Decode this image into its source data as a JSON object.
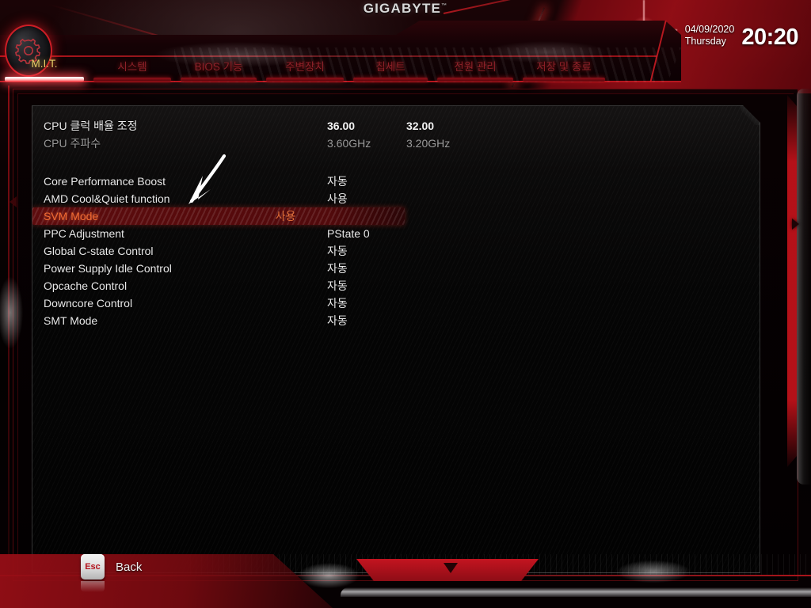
{
  "brand": {
    "logo": "GIGABYTE",
    "trademark": "™",
    "gear_icon": "gear-icon"
  },
  "clock": {
    "date": "04/09/2020",
    "weekday": "Thursday",
    "time": "20:20"
  },
  "tabs": [
    {
      "label": "M.I.T.",
      "active": true
    },
    {
      "label": "시스템",
      "active": false
    },
    {
      "label": "BIOS 기능",
      "active": false
    },
    {
      "label": "주변장치",
      "active": false
    },
    {
      "label": "칩세트",
      "active": false
    },
    {
      "label": "전원 관리",
      "active": false
    },
    {
      "label": "저장 및 종료",
      "active": false
    }
  ],
  "settings": {
    "summary_rows": [
      {
        "label": "CPU 클럭 배율 조정",
        "value1": "36.00",
        "value2": "32.00",
        "style": "bold"
      },
      {
        "label": "CPU 주파수",
        "value1": "3.60GHz",
        "value2": "3.20GHz",
        "style": "dim"
      }
    ],
    "option_rows": [
      {
        "label": "Core Performance Boost",
        "value1": "자동",
        "value2": "",
        "selected": false
      },
      {
        "label": "AMD Cool&Quiet function",
        "value1": "사용",
        "value2": "",
        "selected": false
      },
      {
        "label": "SVM Mode",
        "value1": "사용",
        "value2": "",
        "selected": true
      },
      {
        "label": "PPC Adjustment",
        "value1": "PState 0",
        "value2": "",
        "selected": false
      },
      {
        "label": "Global C-state Control",
        "value1": "자동",
        "value2": "",
        "selected": false
      },
      {
        "label": "Power Supply Idle Control",
        "value1": "자동",
        "value2": "",
        "selected": false
      },
      {
        "label": "Opcache Control",
        "value1": "자동",
        "value2": "",
        "selected": false
      },
      {
        "label": "Downcore Control",
        "value1": "자동",
        "value2": "",
        "selected": false
      },
      {
        "label": "SMT Mode",
        "value1": "자동",
        "value2": "",
        "selected": false
      }
    ]
  },
  "footer": {
    "key": "Esc",
    "action": "Back"
  },
  "annotation": {
    "type": "hand-drawn-arrow",
    "points_to": "SVM Mode"
  },
  "nav": {
    "left_arrow": "chevron-left-icon",
    "right_arrow": "chevron-right-icon"
  },
  "colors": {
    "accent_red": "#c41420",
    "active_tab": "#e8cf6a",
    "inactive_tab": "#8d2129",
    "selected_row_text": "#ef6a32",
    "body_text": "#e9e9e9",
    "dim_text": "#9a9a9a"
  }
}
